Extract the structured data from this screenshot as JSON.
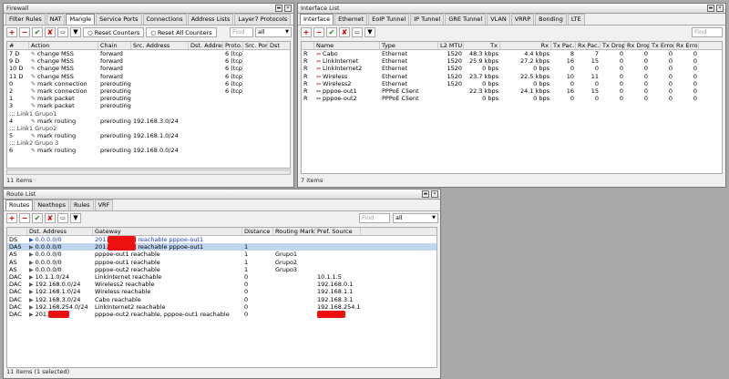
{
  "firewall": {
    "title": "Firewall",
    "tabs": [
      "Filter Rules",
      "NAT",
      "Mangle",
      "Service Ports",
      "Connections",
      "Address Lists",
      "Layer7 Protocols"
    ],
    "active_tab": 2,
    "reset_counters": "Reset Counters",
    "reset_all_counters": "Reset All Counters",
    "find_placeholder": "Find",
    "filter_value": "all",
    "columns": [
      "#",
      "Action",
      "Chain",
      "Src. Address",
      "Dst. Address",
      "Proto...",
      "Src. Port",
      "Dst"
    ],
    "rows": [
      {
        "kind": "rule",
        "n": "7",
        "f": "D",
        "icon": "✎",
        "action": "change MSS",
        "chain": "forward",
        "src": "",
        "dst": "",
        "proto": "6 (tcp)"
      },
      {
        "kind": "rule",
        "n": "9",
        "f": "D",
        "icon": "✎",
        "action": "change MSS",
        "chain": "forward",
        "src": "",
        "dst": "",
        "proto": "6 (tcp)"
      },
      {
        "kind": "rule",
        "n": "10",
        "f": "D",
        "icon": "✎",
        "action": "change MSS",
        "chain": "forward",
        "src": "",
        "dst": "",
        "proto": "6 (tcp)"
      },
      {
        "kind": "rule",
        "n": "11",
        "f": "D",
        "icon": "✎",
        "action": "change MSS",
        "chain": "forward",
        "src": "",
        "dst": "",
        "proto": "6 (tcp)"
      },
      {
        "kind": "rule",
        "n": "0",
        "f": "",
        "icon": "✎",
        "action": "mark connection",
        "chain": "prerouting",
        "src": "",
        "dst": "",
        "proto": "6 (tcp)"
      },
      {
        "kind": "rule",
        "n": "2",
        "f": "",
        "icon": "✎",
        "action": "mark connection",
        "chain": "prerouting",
        "src": "",
        "dst": "",
        "proto": "6 (tcp)"
      },
      {
        "kind": "rule",
        "n": "1",
        "f": "",
        "icon": "✎",
        "action": "mark packet",
        "chain": "prerouting",
        "src": "",
        "dst": "",
        "proto": ""
      },
      {
        "kind": "rule",
        "n": "3",
        "f": "",
        "icon": "✎",
        "action": "mark packet",
        "chain": "prerouting",
        "src": "",
        "dst": "",
        "proto": ""
      },
      {
        "kind": "comment",
        "text": ";;; Link1 Grupo1"
      },
      {
        "kind": "rule",
        "n": "4",
        "f": "",
        "icon": "✎",
        "action": "mark routing",
        "chain": "prerouting",
        "src": "192.168.3.0/24",
        "dst": "",
        "proto": ""
      },
      {
        "kind": "comment",
        "text": ";;; Link1 Grupo2"
      },
      {
        "kind": "rule",
        "n": "5",
        "f": "",
        "icon": "✎",
        "action": "mark routing",
        "chain": "prerouting",
        "src": "192.168.1.0/24",
        "dst": "",
        "proto": ""
      },
      {
        "kind": "comment",
        "text": ";;; Link2 Grupo 3"
      },
      {
        "kind": "rule",
        "n": "6",
        "f": "",
        "icon": "✎",
        "action": "mark routing",
        "chain": "prerouting",
        "src": "192.168.0.0/24",
        "dst": "",
        "proto": ""
      }
    ],
    "status": "11 items"
  },
  "interfaces": {
    "title": "Interface List",
    "tabs": [
      "Interface",
      "Ethernet",
      "EoIP Tunnel",
      "IP Tunnel",
      "GRE Tunnel",
      "VLAN",
      "VRRP",
      "Bonding",
      "LTE"
    ],
    "active_tab": 0,
    "find_placeholder": "Find",
    "columns": [
      "",
      "Name",
      "Type",
      "L2 MTU",
      "Tx",
      "Rx",
      "Tx Pac...",
      "Rx Pac...",
      "Tx Drops",
      "Rx Drops",
      "Tx Errors",
      "Rx Errors"
    ],
    "rows": [
      {
        "f": "R",
        "name": "Cabo",
        "type": "Ethernet",
        "mtu": "1520",
        "tx": "48.3 kbps",
        "rx": "4.4 kbps",
        "txp": "8",
        "rxp": "7",
        "txd": "0",
        "rxd": "0",
        "txe": "0",
        "rxe": "0"
      },
      {
        "f": "R",
        "name": "LinkInternet",
        "type": "Ethernet",
        "mtu": "1520",
        "tx": "25.9 kbps",
        "rx": "27.2 kbps",
        "txp": "16",
        "rxp": "15",
        "txd": "0",
        "rxd": "0",
        "txe": "0",
        "rxe": "0"
      },
      {
        "f": "R",
        "name": "LinkInternet2",
        "type": "Ethernet",
        "mtu": "1520",
        "tx": "0 bps",
        "rx": "0 bps",
        "txp": "0",
        "rxp": "0",
        "txd": "0",
        "rxd": "0",
        "txe": "0",
        "rxe": "0"
      },
      {
        "f": "R",
        "name": "Wireless",
        "type": "Ethernet",
        "mtu": "1520",
        "tx": "23.7 kbps",
        "rx": "22.5 kbps",
        "txp": "10",
        "rxp": "11",
        "txd": "0",
        "rxd": "0",
        "txe": "0",
        "rxe": "0"
      },
      {
        "f": "R",
        "name": "Wireless2",
        "type": "Ethernet",
        "mtu": "1520",
        "tx": "0 bps",
        "rx": "0 bps",
        "txp": "0",
        "rxp": "0",
        "txd": "0",
        "rxd": "0",
        "txe": "0",
        "rxe": "0"
      },
      {
        "f": "R",
        "name": "pppoe-out1",
        "type": "PPPoE Client",
        "mtu": "",
        "tx": "22.3 kbps",
        "rx": "24.1 kbps",
        "txp": "16",
        "rxp": "15",
        "txd": "0",
        "rxd": "0",
        "txe": "0",
        "rxe": "0"
      },
      {
        "f": "R",
        "name": "pppoe-out2",
        "type": "PPPoE Client",
        "mtu": "",
        "tx": "0 bps",
        "rx": "0 bps",
        "txp": "0",
        "rxp": "0",
        "txd": "0",
        "rxd": "0",
        "txe": "0",
        "rxe": "0"
      }
    ],
    "status": "7 items"
  },
  "routes": {
    "title": "Route List",
    "tabs": [
      "Routes",
      "Nexthops",
      "Rules",
      "VRF"
    ],
    "active_tab": 0,
    "find_placeholder": "Find",
    "filter_value": "all",
    "columns": [
      "",
      "Dst. Address",
      "Gateway",
      "Distance",
      "Routing Mark",
      "Pref. Source"
    ],
    "rows": [
      {
        "f": "DS",
        "dst": "0.0.0.0/0",
        "gw_prefix": "201.",
        "redact": true,
        "gw": " reachable pppoe-out1",
        "dist": "",
        "mark": "",
        "src": "",
        "blue": true,
        "sel": false
      },
      {
        "f": "DAS",
        "dst": "0.0.0.0/0",
        "gw_prefix": "201.",
        "redact": true,
        "gw": " reachable pppoe-out1",
        "dist": "1",
        "mark": "",
        "src": "",
        "blue": false,
        "sel": true
      },
      {
        "f": "AS",
        "dst": "0.0.0.0/0",
        "gw_prefix": "",
        "redact": false,
        "gw": "pppoe-out1 reachable",
        "dist": "1",
        "mark": "Grupo1",
        "src": "",
        "blue": false,
        "sel": false
      },
      {
        "f": "AS",
        "dst": "0.0.0.0/0",
        "gw_prefix": "",
        "redact": false,
        "gw": "pppoe-out1 reachable",
        "dist": "1",
        "mark": "Grupo2",
        "src": "",
        "blue": false,
        "sel": false
      },
      {
        "f": "AS",
        "dst": "0.0.0.0/0",
        "gw_prefix": "",
        "redact": false,
        "gw": "pppoe-out2 reachable",
        "dist": "1",
        "mark": "Grupo3",
        "src": "",
        "blue": false,
        "sel": false
      },
      {
        "f": "DAC",
        "dst": "10.1.1.0/24",
        "gw_prefix": "",
        "redact": false,
        "gw": "LinkInternet reachable",
        "dist": "0",
        "mark": "",
        "src": "10.1.1.5",
        "blue": false,
        "sel": false
      },
      {
        "f": "DAC",
        "dst": "192.168.0.0/24",
        "gw_prefix": "",
        "redact": false,
        "gw": "Wireless2 reachable",
        "dist": "0",
        "mark": "",
        "src": "192.168.0.1",
        "blue": false,
        "sel": false
      },
      {
        "f": "DAC",
        "dst": "192.168.1.0/24",
        "gw_prefix": "",
        "redact": false,
        "gw": "Wireless reachable",
        "dist": "0",
        "mark": "",
        "src": "192.168.1.1",
        "blue": false,
        "sel": false
      },
      {
        "f": "DAC",
        "dst": "192.168.3.0/24",
        "gw_prefix": "",
        "redact": false,
        "gw": "Cabo reachable",
        "dist": "0",
        "mark": "",
        "src": "192.168.3.1",
        "blue": false,
        "sel": false
      },
      {
        "f": "DAC",
        "dst": "192.168.254.0/24",
        "gw_prefix": "",
        "redact": false,
        "gw": "LinkInternet2 reachable",
        "dist": "0",
        "mark": "",
        "src": "192.168.254.1",
        "blue": false,
        "sel": false
      },
      {
        "f": "DAC",
        "dst": "201.",
        "dst_redact": true,
        "gw_prefix": "",
        "redact": false,
        "gw": "pppoe-out2 reachable, pppoe-out1 reachable",
        "dist": "0",
        "mark": "",
        "src": "",
        "src_redact": true,
        "blue": false,
        "sel": false
      }
    ],
    "status": "11 items (1 selected)"
  },
  "colors": {
    "selection": "#bed6f0",
    "redaction": "#e11111",
    "route_blue": "#1a3fd0"
  }
}
